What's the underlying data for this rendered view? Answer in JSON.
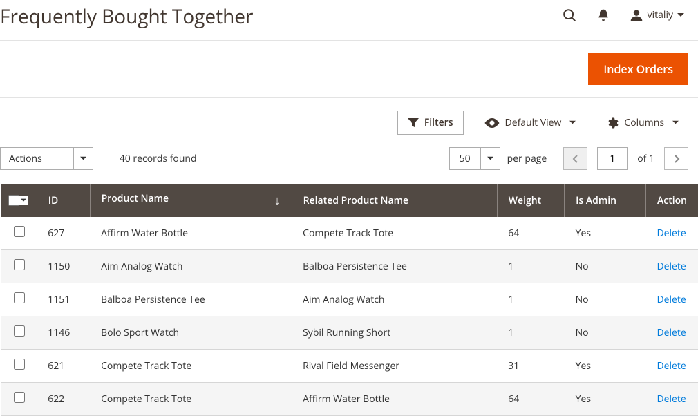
{
  "page_title": "Frequently Bought Together",
  "user_name": "vitaliy",
  "btn_index": "Index Orders",
  "filters_label": "Filters",
  "default_view_label": "Default View",
  "columns_label": "Columns",
  "actions_label": "Actions",
  "records_found": "40 records found",
  "per_page_value": "50",
  "per_page_label": "per page",
  "page_current": "1",
  "page_of": "of 1",
  "columns": {
    "id": "ID",
    "product_name": "Product Name",
    "related_product_name": "Related Product Name",
    "weight": "Weight",
    "is_admin": "Is Admin",
    "action": "Action"
  },
  "action_delete": "Delete",
  "rows": [
    {
      "id": "627",
      "pn": "Affirm Water Bottle",
      "rpn": "Compete Track Tote",
      "w": "64",
      "ia": "Yes"
    },
    {
      "id": "1150",
      "pn": "Aim Analog Watch",
      "rpn": "Balboa Persistence Tee",
      "w": "1",
      "ia": "No"
    },
    {
      "id": "1151",
      "pn": "Balboa Persistence Tee",
      "rpn": "Aim Analog Watch",
      "w": "1",
      "ia": "No"
    },
    {
      "id": "1146",
      "pn": "Bolo Sport Watch",
      "rpn": "Sybil Running Short",
      "w": "1",
      "ia": "No"
    },
    {
      "id": "621",
      "pn": "Compete Track Tote",
      "rpn": "Rival Field Messenger",
      "w": "31",
      "ia": "Yes"
    },
    {
      "id": "622",
      "pn": "Compete Track Tote",
      "rpn": "Affirm Water Bottle",
      "w": "64",
      "ia": "Yes"
    }
  ]
}
